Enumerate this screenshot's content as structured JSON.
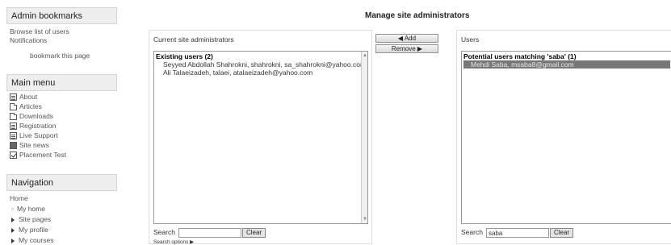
{
  "sidebar": {
    "admin_bookmarks": {
      "title": "Admin bookmarks",
      "links": [
        "Browse list of users",
        "Notifications"
      ],
      "bookmark_label": "bookmark this page"
    },
    "main_menu": {
      "title": "Main menu",
      "items": [
        {
          "label": "About",
          "icon": "page-icon"
        },
        {
          "label": "Articles",
          "icon": "folder-icon"
        },
        {
          "label": "Downloads",
          "icon": "folder-icon"
        },
        {
          "label": "Registration",
          "icon": "page-icon"
        },
        {
          "label": "Live Support",
          "icon": "page-icon"
        },
        {
          "label": "Site news",
          "icon": "forum-icon"
        },
        {
          "label": "Placement Test",
          "icon": "quiz-icon"
        }
      ]
    },
    "navigation": {
      "title": "Navigation",
      "home": "Home",
      "items": [
        "My home",
        "Site pages",
        "My profile",
        "My courses"
      ]
    }
  },
  "main": {
    "title": "Manage site administrators",
    "current": {
      "label": "Current site administrators",
      "group": "Existing users (2)",
      "options": [
        "Seyyed Abdollah Shahrokni, shahrokni, sa_shahrokni@yahoo.com",
        "Ali Talaeizadeh, talaei, atalaeizadeh@yahoo.com"
      ],
      "search_label": "Search",
      "search_value": "",
      "clear_label": "Clear",
      "search_options": "Search options ▶"
    },
    "add_label": "◀ Add",
    "remove_label": "Remove ▶",
    "users": {
      "label": "Users",
      "group": "Potential users matching 'saba' (1)",
      "options": [
        "Mehdi Saba, msaba8@gmail.com"
      ],
      "selected_index": 0,
      "search_label": "Search",
      "search_value": "saba",
      "clear_label": "Clear"
    }
  }
}
